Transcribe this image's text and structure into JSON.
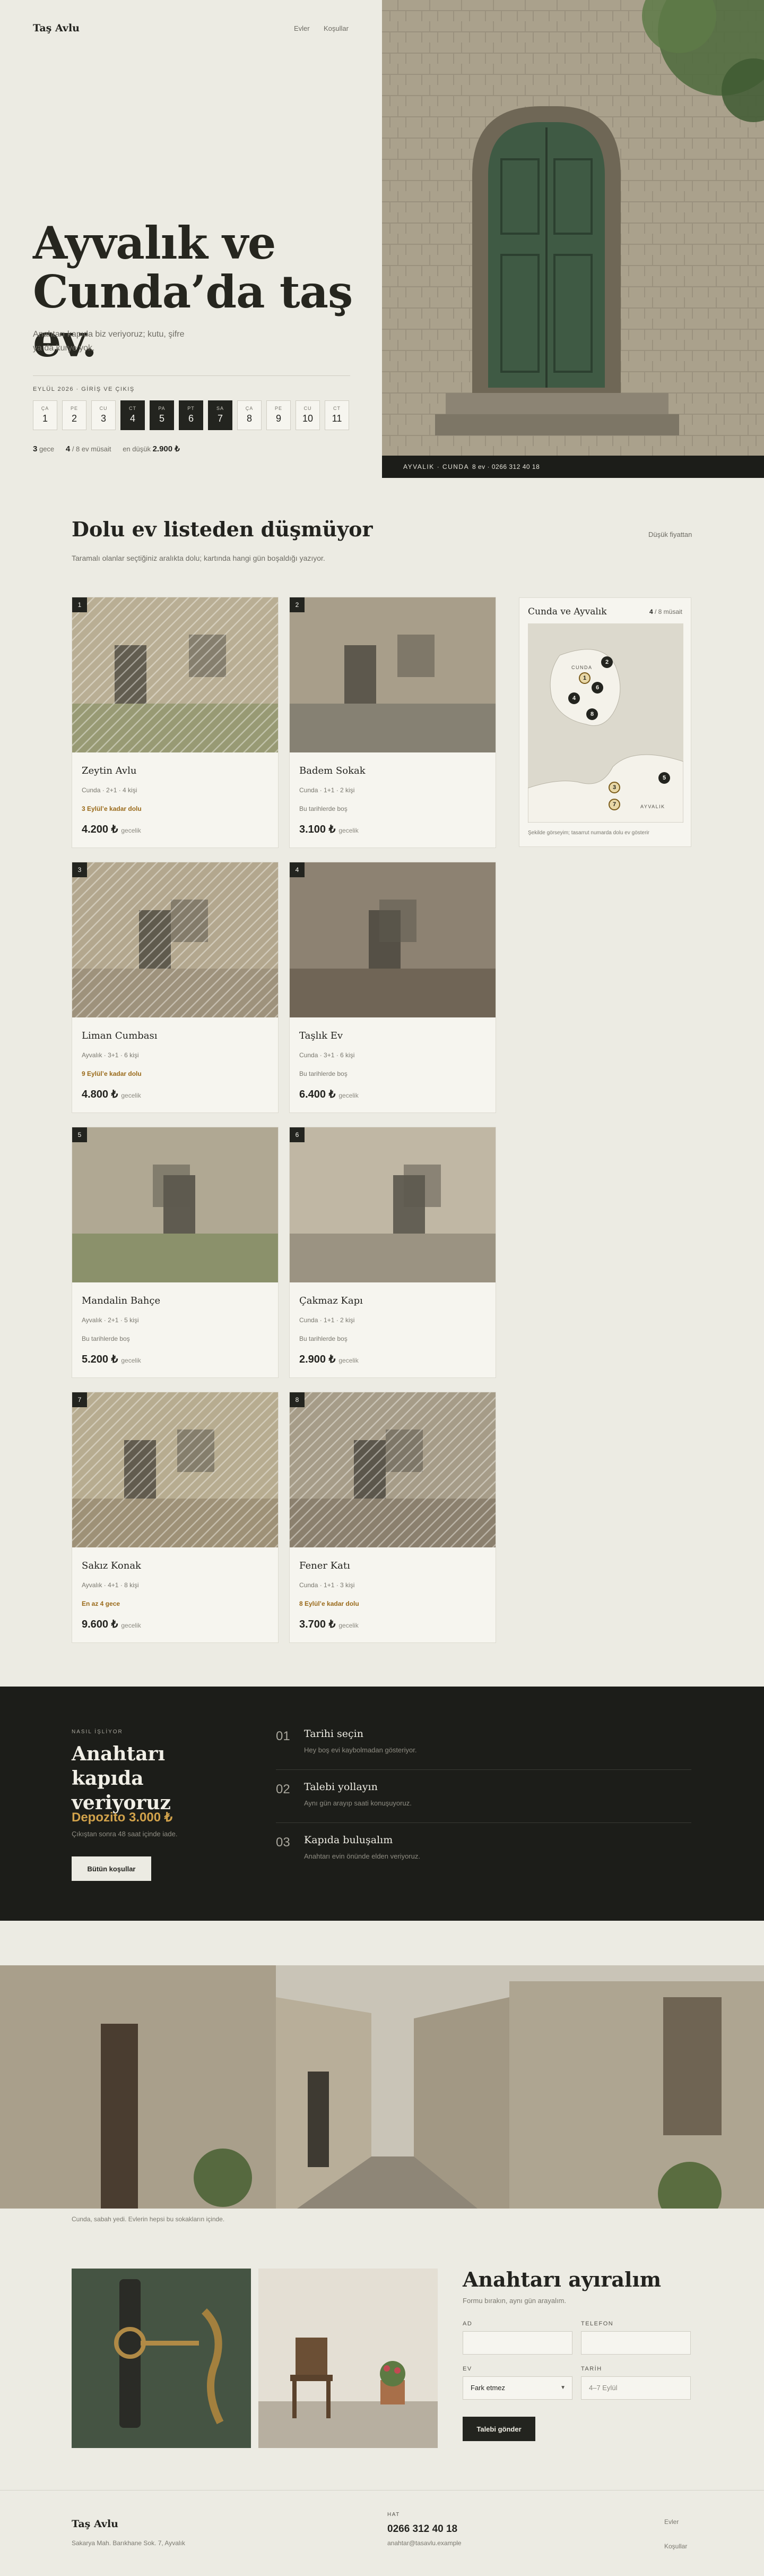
{
  "brand": "Taş Avlu",
  "nav": {
    "homes": "Evler",
    "terms": "Koşullar"
  },
  "hero": {
    "title": "Ayvalık ve Cunda’da taş ev.",
    "subtitle": "Anahtarı kapıda biz veriyoruz; kutu, şifre ya da kurye yok.",
    "week_label": "EYLÜL 2026 · GİRİŞ VE ÇIKIŞ",
    "days": [
      {
        "d": "ÇA",
        "n": "1",
        "sel": false
      },
      {
        "d": "PE",
        "n": "2",
        "sel": false
      },
      {
        "d": "CU",
        "n": "3",
        "sel": false
      },
      {
        "d": "CT",
        "n": "4",
        "sel": true
      },
      {
        "d": "PA",
        "n": "5",
        "sel": true
      },
      {
        "d": "PT",
        "n": "6",
        "sel": true
      },
      {
        "d": "SA",
        "n": "7",
        "sel": true
      },
      {
        "d": "ÇA",
        "n": "8",
        "sel": false
      },
      {
        "d": "PE",
        "n": "9",
        "sel": false
      },
      {
        "d": "CU",
        "n": "10",
        "sel": false
      },
      {
        "d": "CT",
        "n": "11",
        "sel": false
      }
    ],
    "stats": {
      "nights": "3",
      "nights_label": "gece",
      "available": "4",
      "available_label": "/ 8 ev müsait",
      "from_label": "en düşük",
      "from_price": "2.900 ₺"
    },
    "photo_bar": {
      "place": "AYVALIK · CUNDA",
      "contact": "8 ev · 0266 312 40 18"
    }
  },
  "listings": {
    "title": "Dolu ev listeden düşmüyor",
    "subtitle": "Taramalı olanlar seçtiğiniz aralıkta dolu; kartında hangi gün boşaldığı yazıyor.",
    "sort": "Düşük fiyattan",
    "per_night": "gecelik",
    "cards": [
      {
        "num": "1",
        "name": "Zeytin Avlu",
        "meta": "Cunda · 2+1 · 4 kişi",
        "avail": "3 Eylül’e kadar dolu",
        "booked": true,
        "price": "4.200 ₺"
      },
      {
        "num": "2",
        "name": "Badem Sokak",
        "meta": "Cunda · 1+1 · 2 kişi",
        "avail": "Bu tarihlerde boş",
        "booked": false,
        "price": "3.100 ₺"
      },
      {
        "num": "3",
        "name": "Liman Cumbası",
        "meta": "Ayvalık · 3+1 · 6 kişi",
        "avail": "9 Eylül’e kadar dolu",
        "booked": true,
        "price": "4.800 ₺"
      },
      {
        "num": "4",
        "name": "Taşlık Ev",
        "meta": "Cunda · 3+1 · 6 kişi",
        "avail": "Bu tarihlerde boş",
        "booked": false,
        "price": "6.400 ₺"
      },
      {
        "num": "5",
        "name": "Mandalin Bahçe",
        "meta": "Ayvalık · 2+1 · 5 kişi",
        "avail": "Bu tarihlerde boş",
        "booked": false,
        "price": "5.200 ₺"
      },
      {
        "num": "6",
        "name": "Çakmaz Kapı",
        "meta": "Cunda · 1+1 · 2 kişi",
        "avail": "Bu tarihlerde boş",
        "booked": false,
        "price": "2.900 ₺"
      },
      {
        "num": "7",
        "name": "Sakız Konak",
        "meta": "Ayvalık · 4+1 · 8 kişi",
        "avail": "En az 4 gece",
        "booked": true,
        "price": "9.600 ₺"
      },
      {
        "num": "8",
        "name": "Fener Katı",
        "meta": "Cunda · 1+1 · 3 kişi",
        "avail": "8 Eylül’e kadar dolu",
        "booked": true,
        "price": "3.700 ₺"
      }
    ],
    "map": {
      "title": "Cunda ve Ayvalık",
      "count": "4",
      "count_label": "/ 8 müsait",
      "label_cunda": "CUNDA",
      "label_ayvalik": "AYVALIK",
      "caption": "Şekilde görseyim; tasarrut numarda dolu ev gösterir"
    }
  },
  "how": {
    "eyebrow": "NASIL İŞLİYOR",
    "title": "Anahtarı kapıda veriyoruz",
    "deposit": "Depozito 3.000 ₺",
    "deposit_note": "Çıkıştan sonra 48 saat içinde iade.",
    "terms_button": "Bütün koşullar",
    "steps": [
      {
        "n": "01",
        "t": "Tarihi seçin",
        "d": "Hey boş evi kaybolmadan gösteriyor."
      },
      {
        "n": "02",
        "t": "Talebi yollayın",
        "d": "Aynı gün arayıp saati konuşuyoruz."
      },
      {
        "n": "03",
        "t": "Kapıda buluşalım",
        "d": "Anahtarı evin önünde elden veriyoruz."
      }
    ]
  },
  "street_caption": "Cunda, sabah yedi. Evlerin hepsi bu sokakların içinde.",
  "booking": {
    "title": "Anahtarı ayıralım",
    "subtitle": "Formu bırakın, aynı gün arayalım.",
    "name_label": "AD",
    "phone_label": "TELEFON",
    "home_label": "EV",
    "home_value": "Fark etmez",
    "date_label": "TARİH",
    "date_placeholder": "4–7 Eylül",
    "submit": "Talebi gönder"
  },
  "footer": {
    "brand": "Taş Avlu",
    "address": "Sakarya Mah. Barıkhane Sok. 7, Ayvalık",
    "line_label": "HAT",
    "phone": "0266 312 40 18",
    "email": "anahtar@tasavlu.example",
    "homes": "Evler",
    "terms": "Koşullar"
  },
  "colors": {
    "ink": "#23231f",
    "paper": "#ecebe3",
    "card": "#f6f5ef",
    "dark": "#1c1d19",
    "accent": "#b8862c"
  }
}
